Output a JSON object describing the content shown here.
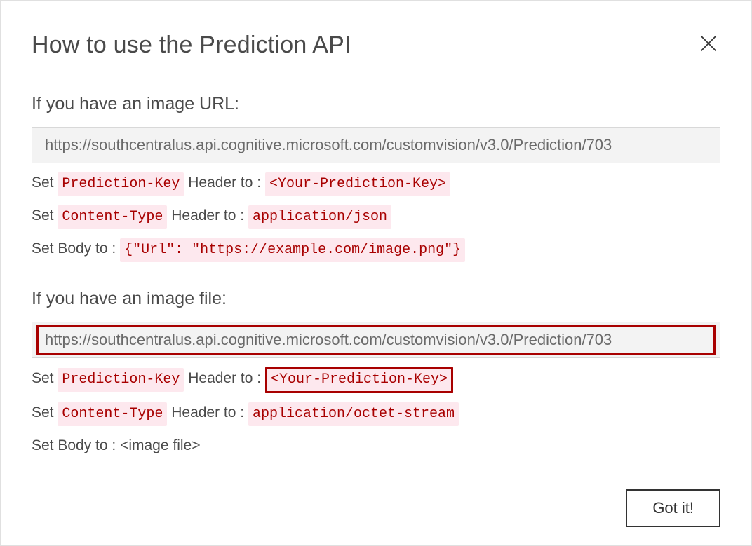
{
  "dialog": {
    "title": "How to use the Prediction API",
    "gotItLabel": "Got it!"
  },
  "urlSection": {
    "heading": "If you have an image URL:",
    "endpoint": "https://southcentralus.api.cognitive.microsoft.com/customvision/v3.0/Prediction/703",
    "line1_prefix": "Set ",
    "line1_chip1": "Prediction-Key",
    "line1_mid": " Header to : ",
    "line1_chip2": "<Your-Prediction-Key>",
    "line2_prefix": "Set ",
    "line2_chip1": "Content-Type",
    "line2_mid": " Header to : ",
    "line2_chip2": "application/json",
    "line3_prefix": "Set Body to : ",
    "line3_chip": "{\"Url\": \"https://example.com/image.png\"}"
  },
  "fileSection": {
    "heading": "If you have an image file:",
    "endpoint": "https://southcentralus.api.cognitive.microsoft.com/customvision/v3.0/Prediction/703",
    "line1_prefix": "Set ",
    "line1_chip1": "Prediction-Key",
    "line1_mid": " Header to : ",
    "line1_chip2": "<Your-Prediction-Key>",
    "line2_prefix": "Set ",
    "line2_chip1": "Content-Type",
    "line2_mid": " Header to : ",
    "line2_chip2": "application/octet-stream",
    "line3": "Set Body to : <image file>"
  }
}
